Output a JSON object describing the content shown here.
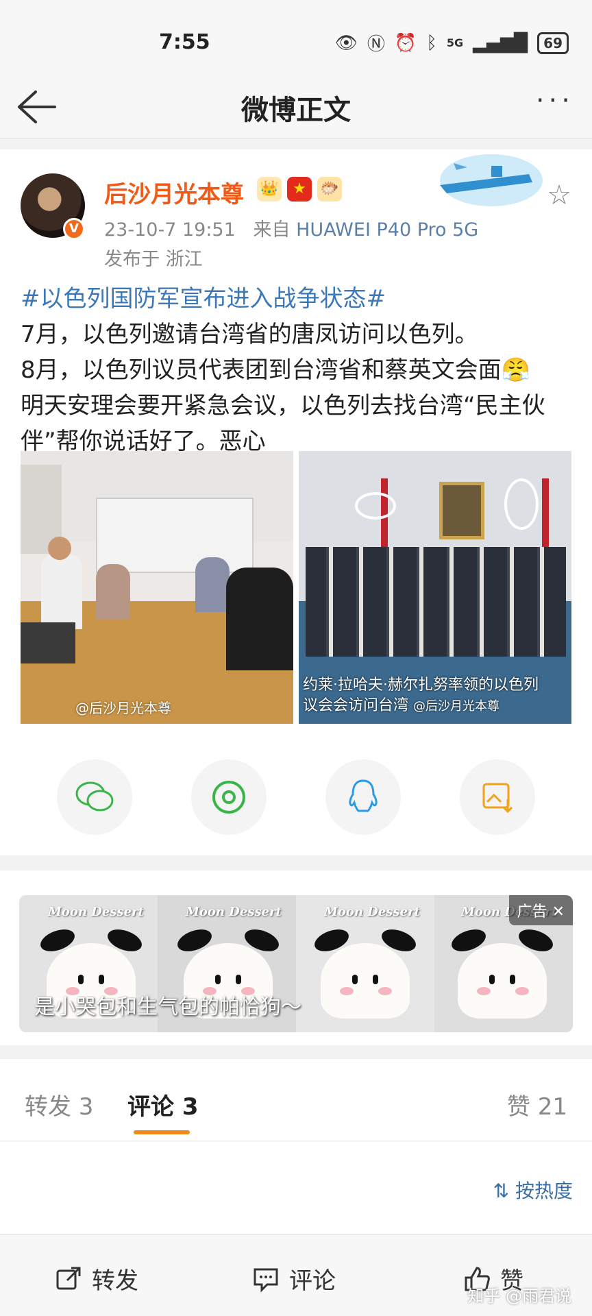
{
  "status_bar": {
    "time": "7:55",
    "battery": "69",
    "network": "5G"
  },
  "header": {
    "title": "微博正文",
    "more": "···"
  },
  "post": {
    "username": "后沙月光本尊",
    "timestamp": "23-10-7 19:51",
    "source_prefix": "来自",
    "device": "HUAWEI P40 Pro 5G",
    "location": "发布于 浙江",
    "topic": "#以色列国防军宣布进入战争状态#",
    "lines": [
      "7月，以色列邀请台湾省的唐凤访问以色列。",
      "8月，以色列议员代表团到台湾省和蔡英文会面😤",
      "明天安理会要开紧急会议，以色列去找台湾“民主伙伴”帮你说话好了。恶心"
    ],
    "image1_watermark": "@后沙月光本尊",
    "image2_caption_line1": "约莱·拉哈夫·赫尔扎努率领的以色列",
    "image2_caption_line2": "议会会访问台湾",
    "image2_watermark": "@后沙月光本尊"
  },
  "share_icons": [
    "wechat-icon",
    "moments-icon",
    "qq-icon",
    "save-image-icon"
  ],
  "ad": {
    "brand": "Moon Dessert",
    "tag": "广告",
    "close": "✕",
    "text": "是小哭包和生气包的帕恰狗～"
  },
  "tabs": {
    "repost": "转发 3",
    "comment": "评论 3",
    "like": "赞 21"
  },
  "sort_label": "按热度",
  "bottom_bar": {
    "repost": "转发",
    "comment": "评论",
    "like": "赞"
  },
  "watermark": "知乎 @雨君说",
  "colors": {
    "accent": "#f08a1c",
    "username": "#f05a16",
    "link": "#3b78b8"
  }
}
